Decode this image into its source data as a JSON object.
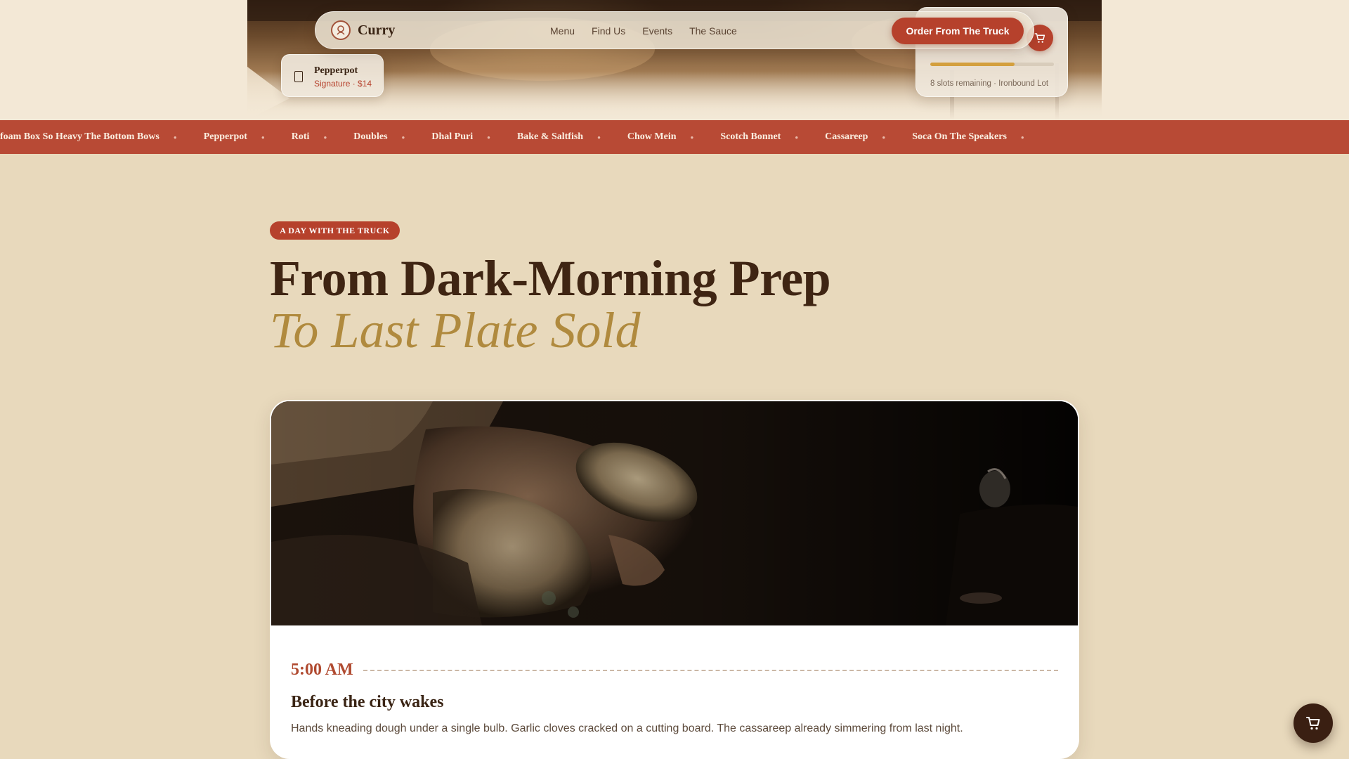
{
  "header": {
    "brand_name": "Curry",
    "nav": [
      "Menu",
      "Find Us",
      "Events",
      "The Sauce"
    ],
    "order_button": "Order From The Truck"
  },
  "slots_card": {
    "remaining_text": "8 slots remaining · Ironbound Lot",
    "progress_fraction": 0.68
  },
  "signature_card": {
    "name": "Pepperpot",
    "meta": "Signature · $14"
  },
  "marquee": {
    "items": [
      "foam Box So Heavy The Bottom Bows",
      "Pepperpot",
      "Roti",
      "Doubles",
      "Dhal Puri",
      "Bake & Saltfish",
      "Chow Mein",
      "Scotch Bonnet",
      "Cassareep",
      "Soca On The Speakers"
    ]
  },
  "hero": {
    "badge": "A DAY WITH THE TRUCK",
    "title_line1": "From Dark-Morning Prep",
    "title_line2": "To Last Plate Sold"
  },
  "timeline": {
    "time": "5:00 AM",
    "title": "Before the city wakes",
    "description": "Hands kneading dough under a single bulb. Garlic cloves cracked on a cutting board. The cassareep already simmering from last night."
  },
  "colors": {
    "accent": "#b6412c",
    "gold": "#b08a3e",
    "dark": "#3a2414",
    "background": "#e8d9bc"
  },
  "icons": [
    "logo-icon",
    "cart-icon",
    "document-icon",
    "cart-fab-icon"
  ]
}
